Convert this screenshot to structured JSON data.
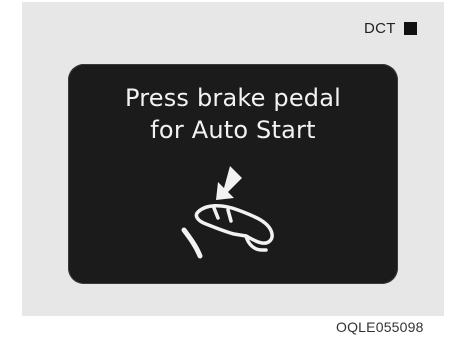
{
  "header": {
    "tag_label": "DCT"
  },
  "display": {
    "message_line_1": "Press brake pedal",
    "message_line_2": "for Auto Start",
    "icon": "brake-pedal-press-icon"
  },
  "figure": {
    "code": "OQLE055098"
  },
  "colors": {
    "panel_background": "#e7e7e7",
    "screen_background": "#1b1b1b",
    "screen_text": "#f2f2f2"
  }
}
